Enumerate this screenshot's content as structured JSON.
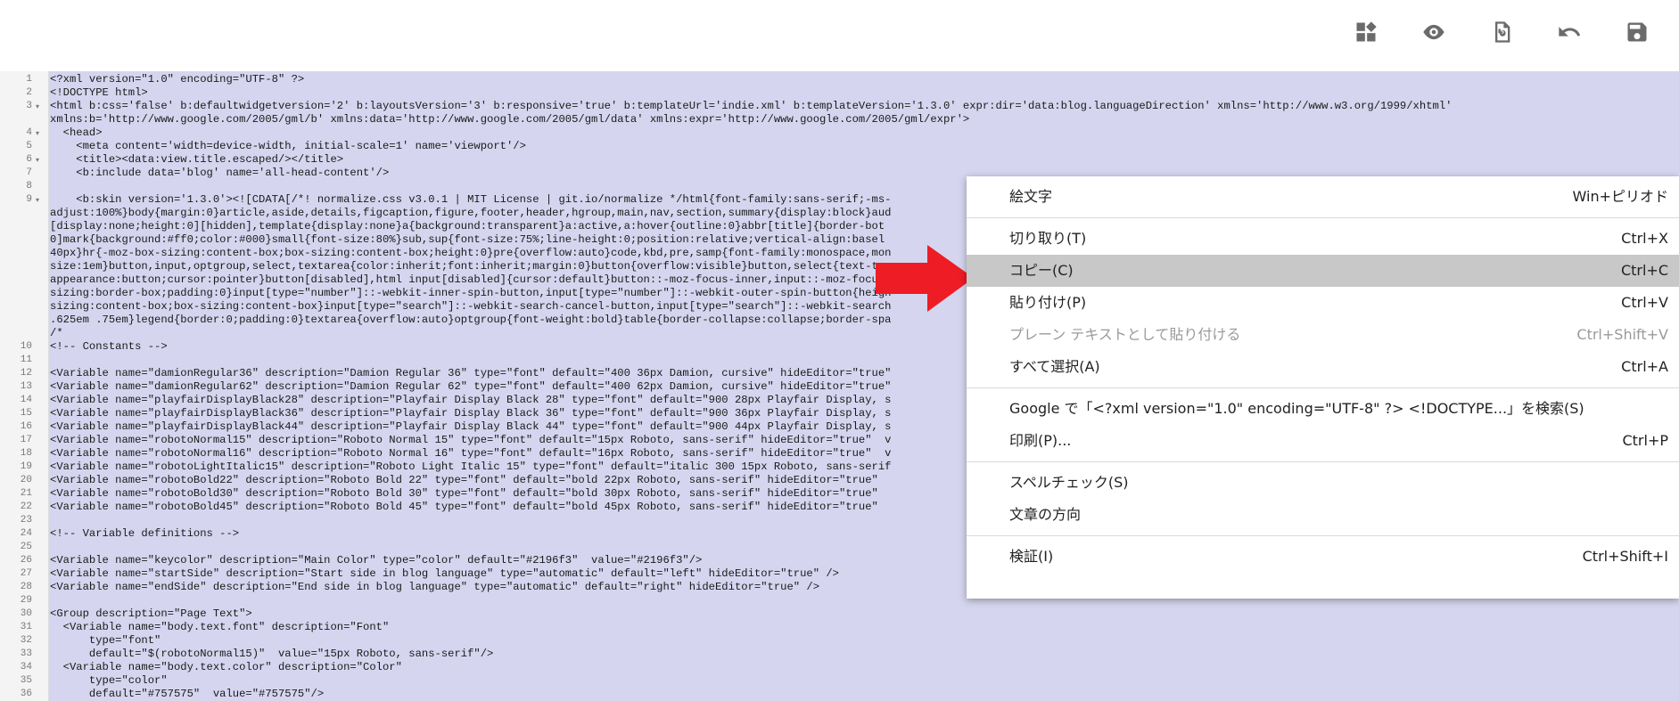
{
  "colors": {
    "code_bg": "#d5d5ef",
    "string": "#b8004a",
    "arrow": "#ee1c25",
    "icon": "#6b6b6b"
  },
  "toolbar": {
    "icons": [
      "layout-icon",
      "preview-icon",
      "revert-icon",
      "undo-icon",
      "save-icon"
    ]
  },
  "editor": {
    "lines": [
      {
        "n": "1",
        "t": "<?xml version=\"1.0\" encoding=\"UTF-8\" ?>"
      },
      {
        "n": "2",
        "t": "<!DOCTYPE html>"
      },
      {
        "n": "3",
        "t": "<html b:css='false' b:defaultwidgetversion='2' b:layoutsVersion='3' b:responsive='true' b:templateUrl='indie.xml' b:templateVersion='1.3.0' expr:dir='data:blog.languageDirection' xmlns='http://www.w3.org/1999/xhtml'"
      },
      {
        "n": "",
        "t": "xmlns:b='http://www.google.com/2005/gml/b' xmlns:data='http://www.google.com/2005/gml/data' xmlns:expr='http://www.google.com/2005/gml/expr'>"
      },
      {
        "n": "4",
        "t": "  <head>"
      },
      {
        "n": "5",
        "t": "    <meta content='width=device-width, initial-scale=1' name='viewport'/>"
      },
      {
        "n": "6",
        "t": "    <title><data:view.title.escaped/></title>"
      },
      {
        "n": "7",
        "t": "    <b:include data='blog' name='all-head-content'/>"
      },
      {
        "n": "8",
        "t": ""
      },
      {
        "n": "9",
        "t": "    <b:skin version='1.3.0'><![CDATA[/*! normalize.css v3.0.1 | MIT License | git.io/normalize */html{font-family:sans-serif;-ms-"
      },
      {
        "n": "",
        "t": "adjust:100%}body{margin:0}article,aside,details,figcaption,figure,footer,header,hgroup,main,nav,section,summary{display:block}aud"
      },
      {
        "n": "",
        "t": "[display:none;height:0][hidden],template{display:none}a{background:transparent}a:active,a:hover{outline:0}abbr[title]{border-bot"
      },
      {
        "n": "",
        "t": "0]mark{background:#ff0;color:#000}small{font-size:80%}sub,sup{font-size:75%;line-height:0;position:relative;vertical-align:basel"
      },
      {
        "n": "",
        "t": "40px}hr{-moz-box-sizing:content-box;box-sizing:content-box;height:0}pre{overflow:auto}code,kbd,pre,samp{font-family:monospace,mon"
      },
      {
        "n": "",
        "t": "size:1em}button,input,optgroup,select,textarea{color:inherit;font:inherit;margin:0}button{overflow:visible}button,select{text-tra"
      },
      {
        "n": "",
        "t": "appearance:button;cursor:pointer}button[disabled],html input[disabled]{cursor:default}button::-moz-focus-inner,input::-moz-focu"
      },
      {
        "n": "",
        "t": "sizing:border-box;padding:0}input[type=\"number\"]::-webkit-inner-spin-button,input[type=\"number\"]::-webkit-outer-spin-button{heigh"
      },
      {
        "n": "",
        "t": "sizing:content-box;box-sizing:content-box}input[type=\"search\"]::-webkit-search-cancel-button,input[type=\"search\"]::-webkit-search"
      },
      {
        "n": "",
        "t": ".625em .75em}legend{border:0;padding:0}textarea{overflow:auto}optgroup{font-weight:bold}table{border-collapse:collapse;border-spa"
      },
      {
        "n": "",
        "t": "/*"
      },
      {
        "n": "10",
        "t": "<!-- Constants -->"
      },
      {
        "n": "11",
        "t": ""
      },
      {
        "n": "12",
        "t": "<Variable name=\"damionRegular36\" description=\"Damion Regular 36\" type=\"font\" default=\"400 36px Damion, cursive\" hideEditor=\"true\""
      },
      {
        "n": "13",
        "t": "<Variable name=\"damionRegular62\" description=\"Damion Regular 62\" type=\"font\" default=\"400 62px Damion, cursive\" hideEditor=\"true\""
      },
      {
        "n": "14",
        "t": "<Variable name=\"playfairDisplayBlack28\" description=\"Playfair Display Black 28\" type=\"font\" default=\"900 28px Playfair Display, s"
      },
      {
        "n": "15",
        "t": "<Variable name=\"playfairDisplayBlack36\" description=\"Playfair Display Black 36\" type=\"font\" default=\"900 36px Playfair Display, s"
      },
      {
        "n": "16",
        "t": "<Variable name=\"playfairDisplayBlack44\" description=\"Playfair Display Black 44\" type=\"font\" default=\"900 44px Playfair Display, s"
      },
      {
        "n": "17",
        "t": "<Variable name=\"robotoNormal15\" description=\"Roboto Normal 15\" type=\"font\" default=\"15px Roboto, sans-serif\" hideEditor=\"true\"  v"
      },
      {
        "n": "18",
        "t": "<Variable name=\"robotoNormal16\" description=\"Roboto Normal 16\" type=\"font\" default=\"16px Roboto, sans-serif\" hideEditor=\"true\"  v"
      },
      {
        "n": "19",
        "t": "<Variable name=\"robotoLightItalic15\" description=\"Roboto Light Italic 15\" type=\"font\" default=\"italic 300 15px Roboto, sans-serif"
      },
      {
        "n": "20",
        "t": "<Variable name=\"robotoBold22\" description=\"Roboto Bold 22\" type=\"font\" default=\"bold 22px Roboto, sans-serif\" hideEditor=\"true\""
      },
      {
        "n": "21",
        "t": "<Variable name=\"robotoBold30\" description=\"Roboto Bold 30\" type=\"font\" default=\"bold 30px Roboto, sans-serif\" hideEditor=\"true\""
      },
      {
        "n": "22",
        "t": "<Variable name=\"robotoBold45\" description=\"Roboto Bold 45\" type=\"font\" default=\"bold 45px Roboto, sans-serif\" hideEditor=\"true\""
      },
      {
        "n": "23",
        "t": ""
      },
      {
        "n": "24",
        "t": "<!-- Variable definitions -->"
      },
      {
        "n": "25",
        "t": ""
      },
      {
        "n": "26",
        "t": "<Variable name=\"keycolor\" description=\"Main Color\" type=\"color\" default=\"#2196f3\"  value=\"#2196f3\"/>"
      },
      {
        "n": "27",
        "t": "<Variable name=\"startSide\" description=\"Start side in blog language\" type=\"automatic\" default=\"left\" hideEditor=\"true\" />"
      },
      {
        "n": "28",
        "t": "<Variable name=\"endSide\" description=\"End side in blog language\" type=\"automatic\" default=\"right\" hideEditor=\"true\" />"
      },
      {
        "n": "29",
        "t": ""
      },
      {
        "n": "30",
        "t": "<Group description=\"Page Text\">"
      },
      {
        "n": "31",
        "t": "  <Variable name=\"body.text.font\" description=\"Font\""
      },
      {
        "n": "32",
        "t": "      type=\"font\""
      },
      {
        "n": "33",
        "t": "      default=\"$(robotoNormal15)\"  value=\"15px Roboto, sans-serif\"/>"
      },
      {
        "n": "34",
        "t": "  <Variable name=\"body.text.color\" description=\"Color\""
      },
      {
        "n": "35",
        "t": "      type=\"color\""
      },
      {
        "n": "36",
        "t": "      default=\"#757575\"  value=\"#757575\"/>"
      }
    ]
  },
  "context_menu": {
    "items": [
      {
        "label": "絵文字",
        "shortcut": "Win+ピリオド",
        "disabled": false,
        "selected": false
      },
      {
        "sep": true
      },
      {
        "label": "切り取り(T)",
        "shortcut": "Ctrl+X",
        "disabled": false,
        "selected": false
      },
      {
        "label": "コピー(C)",
        "shortcut": "Ctrl+C",
        "disabled": false,
        "selected": true
      },
      {
        "label": "貼り付け(P)",
        "shortcut": "Ctrl+V",
        "disabled": false,
        "selected": false
      },
      {
        "label": "プレーン テキストとして貼り付ける",
        "shortcut": "Ctrl+Shift+V",
        "disabled": true,
        "selected": false
      },
      {
        "label": "すべて選択(A)",
        "shortcut": "Ctrl+A",
        "disabled": false,
        "selected": false
      },
      {
        "sep": true
      },
      {
        "label": "Google で「<?xml version=\"1.0\" encoding=\"UTF-8\" ?> <!DOCTYPE...」を検索(S)",
        "shortcut": "",
        "disabled": false,
        "selected": false
      },
      {
        "label": "印刷(P)...",
        "shortcut": "Ctrl+P",
        "disabled": false,
        "selected": false
      },
      {
        "sep": true
      },
      {
        "label": "スペルチェック(S)",
        "shortcut": "",
        "disabled": false,
        "selected": false
      },
      {
        "label": "文章の方向",
        "shortcut": "",
        "disabled": false,
        "selected": false
      },
      {
        "sep": true
      },
      {
        "label": "検証(I)",
        "shortcut": "Ctrl+Shift+I",
        "disabled": false,
        "selected": false
      }
    ]
  }
}
